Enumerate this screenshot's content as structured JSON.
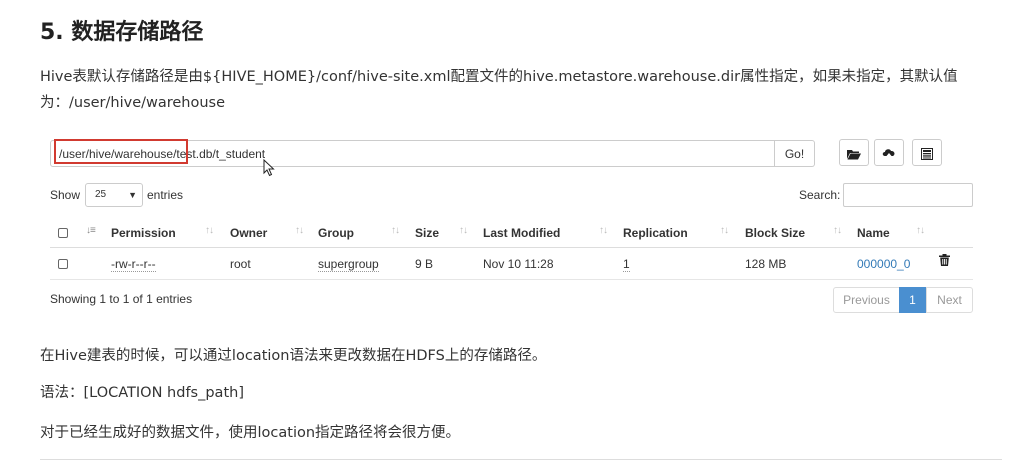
{
  "heading": "5. 数据存储路径",
  "paragraphs": {
    "intro": "Hive表默认存储路径是由${HIVE_HOME}/conf/hive-site.xml配置文件的hive.metastore.warehouse.dir属性指定，如果未指定，其默认值为：/user/hive/warehouse",
    "location": "在Hive建表的时候，可以通过location语法来更改数据在HDFS上的存储路径。",
    "syntax": "语法：[LOCATION hdfs_path]",
    "existing": "对于已经生成好的数据文件，使用location指定路径将会很方便。"
  },
  "browser": {
    "path_value": "/user/hive/warehouse/test.db/t_student",
    "go_label": "Go!",
    "toolbar": {
      "folder_icon": "folder-open-icon",
      "upload_icon": "upload-icon",
      "clipboard_icon": "list-icon"
    },
    "show_label": "Show",
    "page_length": "25",
    "entries_label": "entries",
    "search_label": "Search:",
    "search_value": "",
    "columns": [
      "Permission",
      "Owner",
      "Group",
      "Size",
      "Last Modified",
      "Replication",
      "Block Size",
      "Name"
    ],
    "rows": [
      {
        "permission": "-rw-r--r--",
        "owner": "root",
        "group": "supergroup",
        "size": "9 B",
        "last_modified": "Nov 10 11:28",
        "replication": "1",
        "block_size": "128 MB",
        "name": "000000_0"
      }
    ],
    "info": "Showing 1 to 1 of 1 entries",
    "pagination": {
      "previous": "Previous",
      "current": "1",
      "next": "Next"
    },
    "colors": {
      "highlight_border": "#d13a30",
      "link": "#337ab7",
      "active_page": "#4a8fd0"
    }
  }
}
